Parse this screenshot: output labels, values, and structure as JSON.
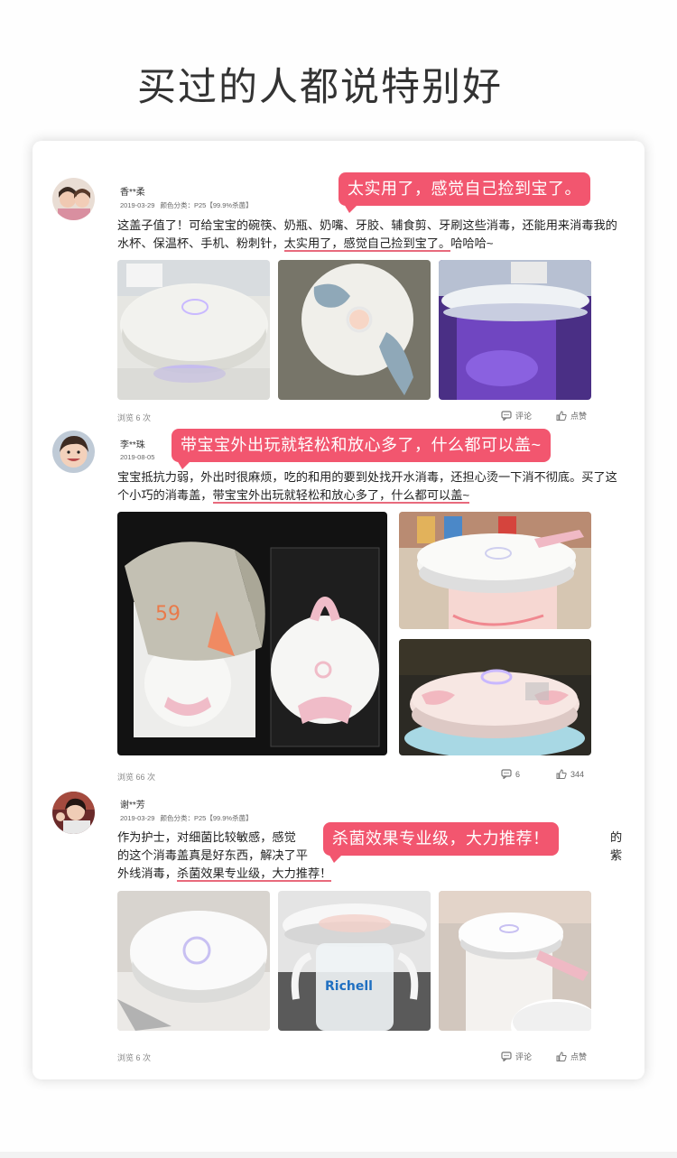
{
  "header": {
    "title": "买过的人都说特别好"
  },
  "icons": {
    "comment": "comment-icon",
    "like": "thumbs-up-icon"
  },
  "colors": {
    "accent": "#f2566f",
    "underline": "#e86a7c"
  },
  "reviews": [
    {
      "user": "香**柔",
      "date": "2019-03-29",
      "meta": "颜色分类：P25【99.9%杀菌】",
      "text_before": "这盖子值了！可给宝宝的碗筷、奶瓶、奶嘴、牙胶、辅食剪、牙刷这些消毒，还能用来消毒我的水杯、保温杯、手机、粉刺针，",
      "text_highlight": "太实用了，感觉自己捡到宝了。",
      "text_after": "哈哈哈~",
      "bubble": "太实用了，感觉自己捡到宝了。",
      "views": "浏览 6 次",
      "comment_label": "评论",
      "like_label": "点赞"
    },
    {
      "user": "李**珠",
      "date": "2019-08-05",
      "meta": "",
      "text_before": "宝宝抵抗力弱，外出时很麻烦，吃的和用的要到处找开水消毒，还担心烫一下消不彻底。买了这个小巧的消毒盖，",
      "text_highlight": "带宝宝外出玩就轻松和放心多了，什么都可以盖~",
      "text_after": "",
      "bubble": "带宝宝外出玩就轻松和放心多了，什么都可以盖~",
      "views": "浏览 66 次",
      "comment_label": "6",
      "like_label": "344"
    },
    {
      "user": "谢**芳",
      "date": "2019-03-29",
      "meta": "颜色分类：P25【99.9%杀菌】",
      "text_before": "作为护士，对细菌比较敏感，感觉",
      "text_hidden": "的这个消毒盖真是好东西，解决了平",
      "text_tail": "外线消毒，",
      "text_right": "的",
      "text_right2": "紫",
      "text_highlight": "杀菌效果专业级，大力推荐！",
      "text_after": "",
      "bubble": "杀菌效果专业级，大力推荐！",
      "views": "浏览 6 次",
      "comment_label": "评论",
      "like_label": "点赞"
    }
  ]
}
